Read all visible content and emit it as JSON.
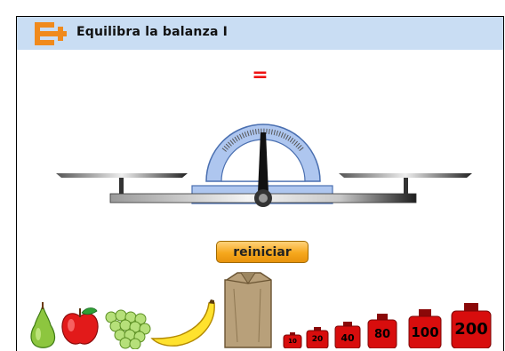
{
  "header": {
    "title": "Equilibra la balanza I",
    "logo_icon": "plus-math-logo-icon"
  },
  "balance": {
    "comparison_sign": "="
  },
  "controls": {
    "reset_label": "reiniciar"
  },
  "fruits": [
    {
      "name": "pear",
      "icon": "pear-icon"
    },
    {
      "name": "apple",
      "icon": "apple-icon"
    },
    {
      "name": "grapes",
      "icon": "grapes-icon"
    },
    {
      "name": "banana",
      "icon": "banana-icon"
    }
  ],
  "bag": {
    "icon": "paper-bag-icon"
  },
  "weights": [
    {
      "label": "10"
    },
    {
      "label": "20"
    },
    {
      "label": "40"
    },
    {
      "label": "80"
    },
    {
      "label": "100"
    },
    {
      "label": "200"
    }
  ],
  "colors": {
    "header": "#c9ddf3",
    "sign": "#e11111",
    "button": "#f6a81d",
    "weight": "#d80d0d",
    "dial": "#aec6ef"
  }
}
